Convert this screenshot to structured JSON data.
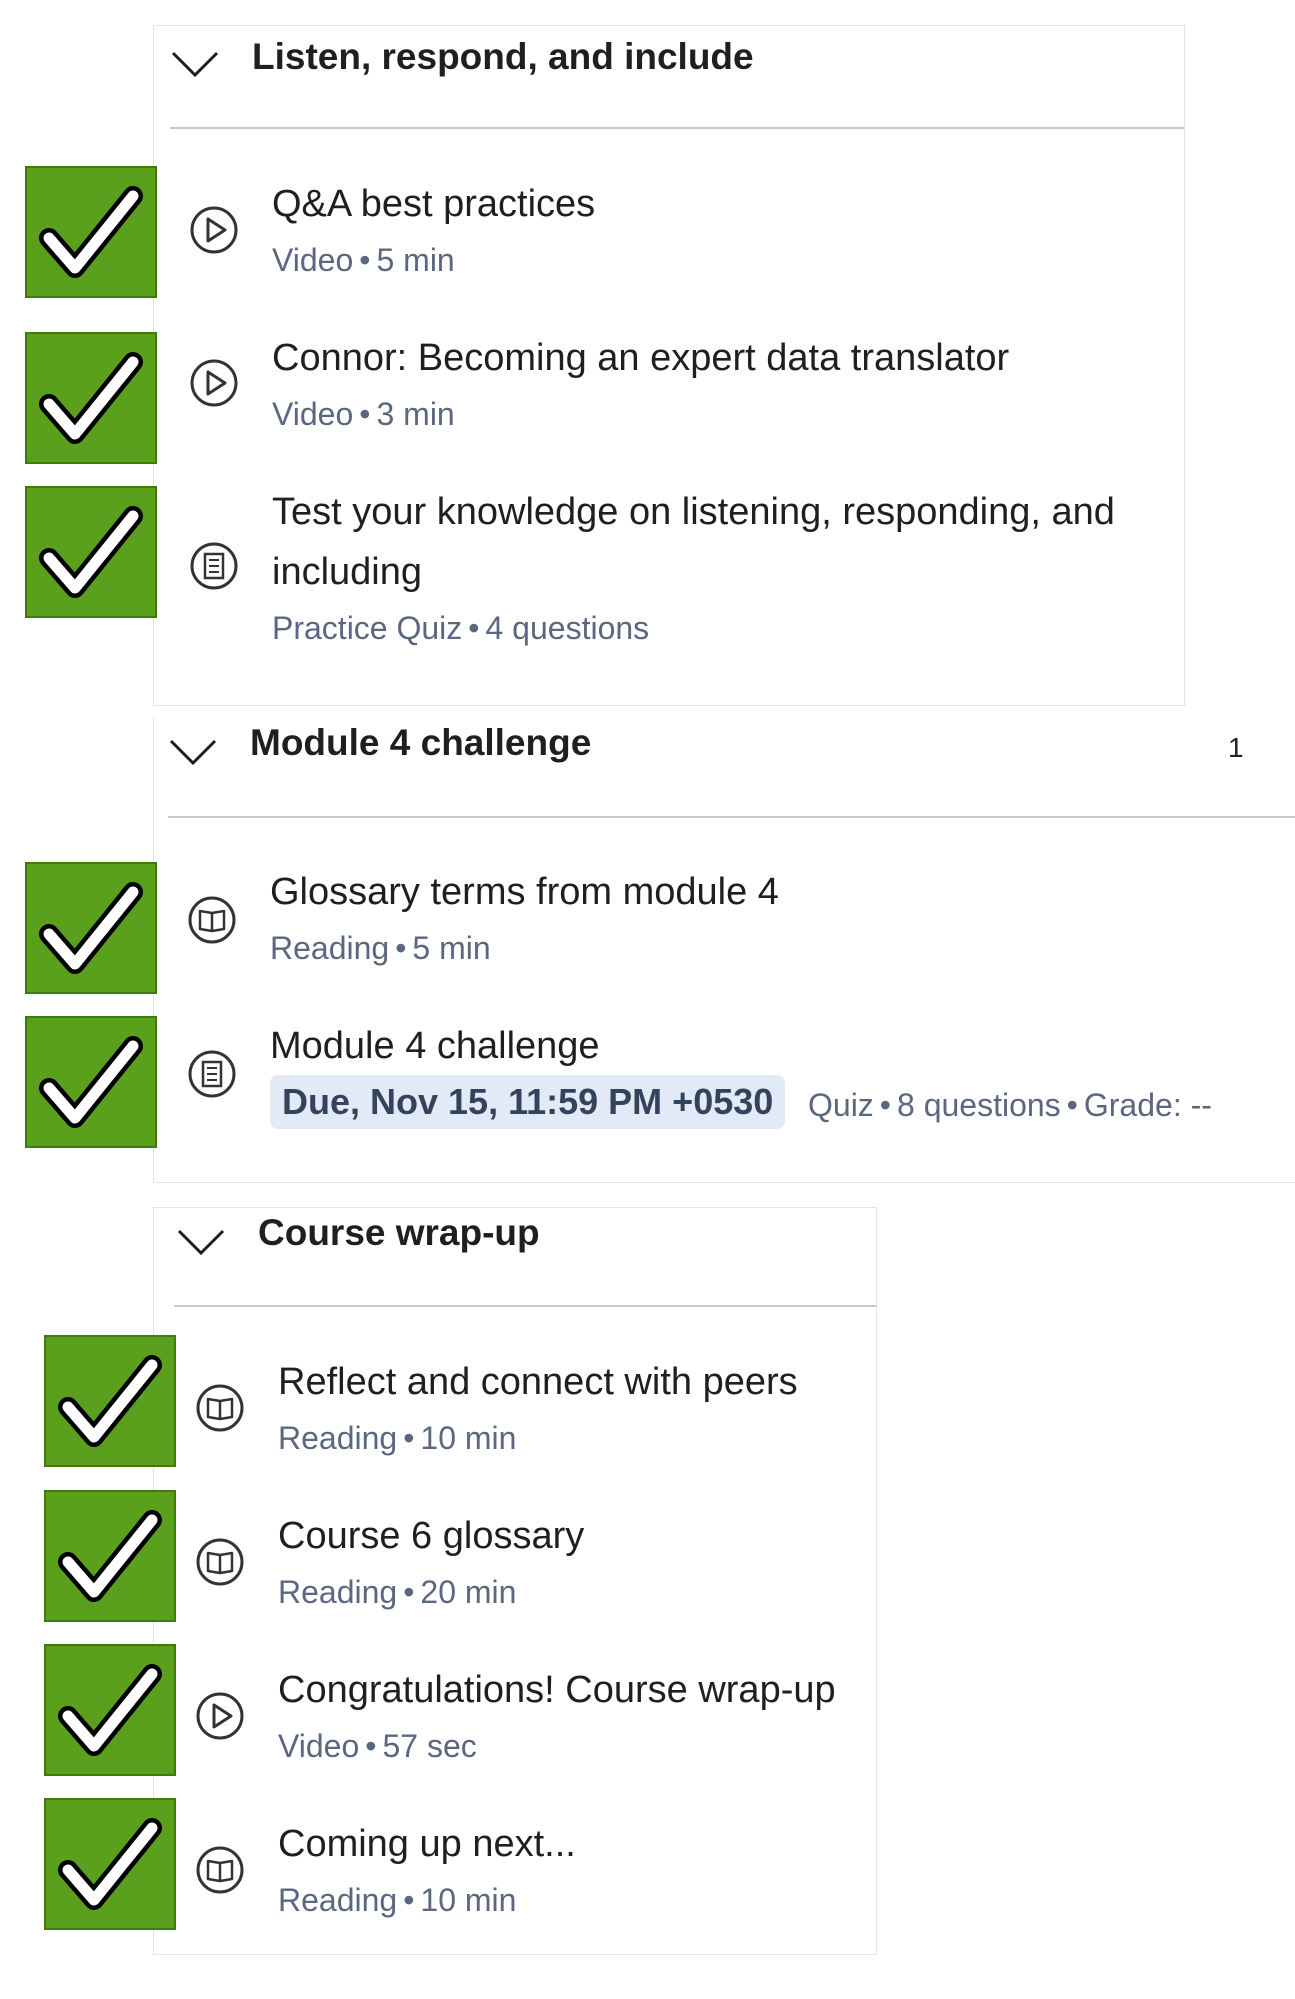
{
  "sections": [
    {
      "title": "Listen, respond, and include",
      "items": [
        {
          "title": "Q&A best practices",
          "type": "Video",
          "detail": "5 min",
          "icon": "play-circle-icon",
          "completed": true
        },
        {
          "title": "Connor: Becoming an expert data translator",
          "type": "Video",
          "detail": "3 min",
          "icon": "play-circle-icon",
          "completed": true
        },
        {
          "title": "Test your knowledge on listening, responding, and including",
          "type": "Practice Quiz",
          "detail": "4 questions",
          "icon": "quiz-icon",
          "completed": true
        }
      ]
    },
    {
      "title": "Module 4 challenge",
      "edge_text": "1",
      "items": [
        {
          "title": "Glossary terms from module 4",
          "type": "Reading",
          "detail": "5 min",
          "icon": "book-icon",
          "completed": true
        },
        {
          "title": "Module 4 challenge",
          "due": "Due, Nov 15, 11:59 PM +0530",
          "type": "Quiz",
          "detail": "8 questions",
          "grade": "Grade: --",
          "icon": "quiz-icon",
          "completed": true
        }
      ]
    },
    {
      "title": "Course wrap-up",
      "items": [
        {
          "title": "Reflect and connect with peers",
          "type": "Reading",
          "detail": "10 min",
          "icon": "book-icon",
          "completed": true
        },
        {
          "title": "Course 6 glossary",
          "type": "Reading",
          "detail": "20 min",
          "icon": "book-icon",
          "completed": true
        },
        {
          "title": "Congratulations! Course wrap-up",
          "type": "Video",
          "detail": "57 sec",
          "icon": "play-circle-icon",
          "completed": true
        },
        {
          "title": "Coming up next...",
          "type": "Reading",
          "detail": "10 min",
          "icon": "book-icon",
          "completed": true
        }
      ]
    }
  ],
  "separator": "•",
  "colors": {
    "check_bg": "#5aa01d",
    "meta_text": "#5b6780",
    "due_bg": "#e3eaf7",
    "separator_line": "#c3cad5"
  }
}
